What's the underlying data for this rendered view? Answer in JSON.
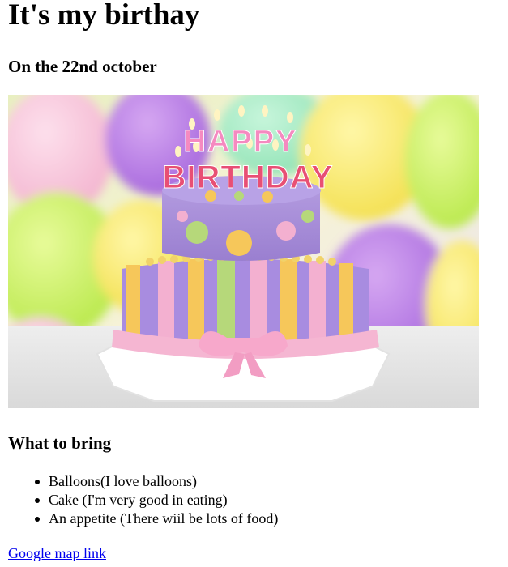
{
  "title": "It's my birthay",
  "subtitle": "On the 22nd october",
  "image": {
    "candle_letters_top": "HAPPY",
    "candle_letters_bottom": "BIRTHDAY"
  },
  "bring_heading": "What to bring",
  "items": [
    "Balloons(I love balloons)",
    "Cake (I'm very good in eating)",
    "An appetite (There wiil be lots of food)"
  ],
  "map_link": "Google map link",
  "colors": {
    "link": "#0000ee",
    "text": "#000000"
  }
}
